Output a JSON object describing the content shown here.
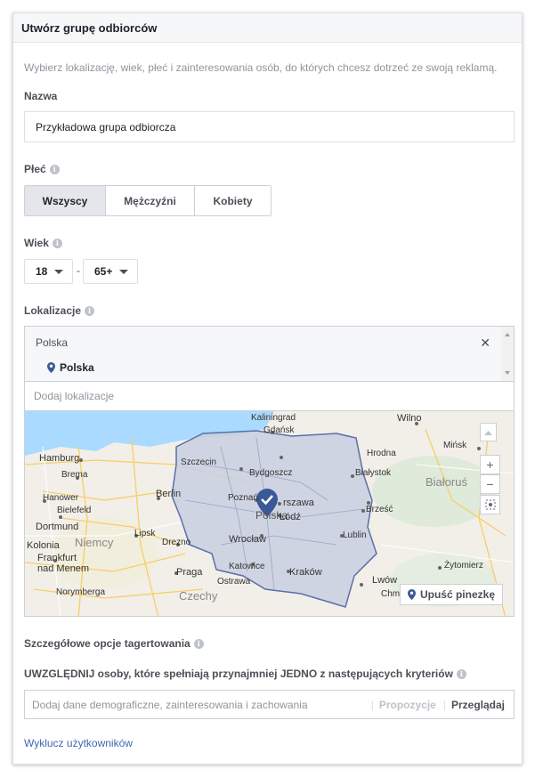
{
  "header": {
    "title": "Utwórz grupę odbiorców"
  },
  "description": "Wybierz lokalizację, wiek, płeć i zainteresowania osób, do których chcesz dotrzeć ze swoją reklamą.",
  "name_field": {
    "label": "Nazwa",
    "value": "Przykładowa grupa odbiorcza"
  },
  "gender": {
    "label": "Płeć",
    "options": [
      "Wszyscy",
      "Mężczyźni",
      "Kobiety"
    ],
    "selected": "Wszyscy"
  },
  "age": {
    "label": "Wiek",
    "min": "18",
    "separator": "-",
    "max": "65+"
  },
  "locations": {
    "label": "Lokalizacje",
    "group_label": "Polska",
    "selected_item": "Polska",
    "placeholder": "Dodaj lokalizacje",
    "map_labels": {
      "kaliningrad": "Kaliningrad",
      "gdansk": "Gdańsk",
      "wilno": "Wilno",
      "hamburg": "Hamburg",
      "brema": "Brema",
      "szczecin": "Szczecin",
      "bydgoszcz": "Bydgoszcz",
      "hrodna": "Hrodna",
      "minsk": "Mińsk",
      "bialystok": "Białystok",
      "bialorus": "Białoruś",
      "hanower": "Hanower",
      "bielefeld": "Bielefeld",
      "berlin": "Berlin",
      "poznan": "Poznań",
      "warszawa": "rszawa",
      "polska": "Polska",
      "lodz": "Łódź",
      "brzesc": "Brześć",
      "dortmund": "Dortmund",
      "lipsk": "Lipsk",
      "kolonia": "Kolonia",
      "niemcy": "Niemcy",
      "drezno": "Drezno",
      "wroclaw": "Wrocław",
      "lublin": "Lublin",
      "frankfurt": "Frankfurt nad Menem",
      "praga": "Praga",
      "katowice": "Katowice",
      "krakow": "Kraków",
      "zytomierz": "Żytomierz",
      "ostrawa": "Ostrawa",
      "norymberga": "Norymberga",
      "czechy": "Czechy",
      "lwow": "Lwów",
      "chmi": "Chmi"
    },
    "zoom_in": "+",
    "zoom_out": "−",
    "drop_pin_label": "Upuść pinezkę"
  },
  "detailed": {
    "label": "Szczegółowe opcje tagertowania",
    "include_label": "UWZGLĘDNIJ osoby, które spełniają przynajmniej JEDNO z następujących kryteriów",
    "placeholder": "Dodaj dane demograficzne, zainteresowania i zachowania",
    "suggestions": "Propozycje",
    "browse": "Przeglądaj",
    "exclude_link": "Wyklucz użytkowników"
  },
  "colors": {
    "accent": "#4267b2",
    "pin": "#3b5998",
    "region_fill": "#c9cfe0",
    "region_border": "#5b6fa8"
  },
  "icons": {
    "info": "info-icon",
    "caret": "caret-down-icon",
    "close": "close-icon",
    "pin": "location-pin-icon",
    "zoom_in": "zoom-in-icon",
    "zoom_out": "zoom-out-icon",
    "locate": "locate-icon"
  }
}
